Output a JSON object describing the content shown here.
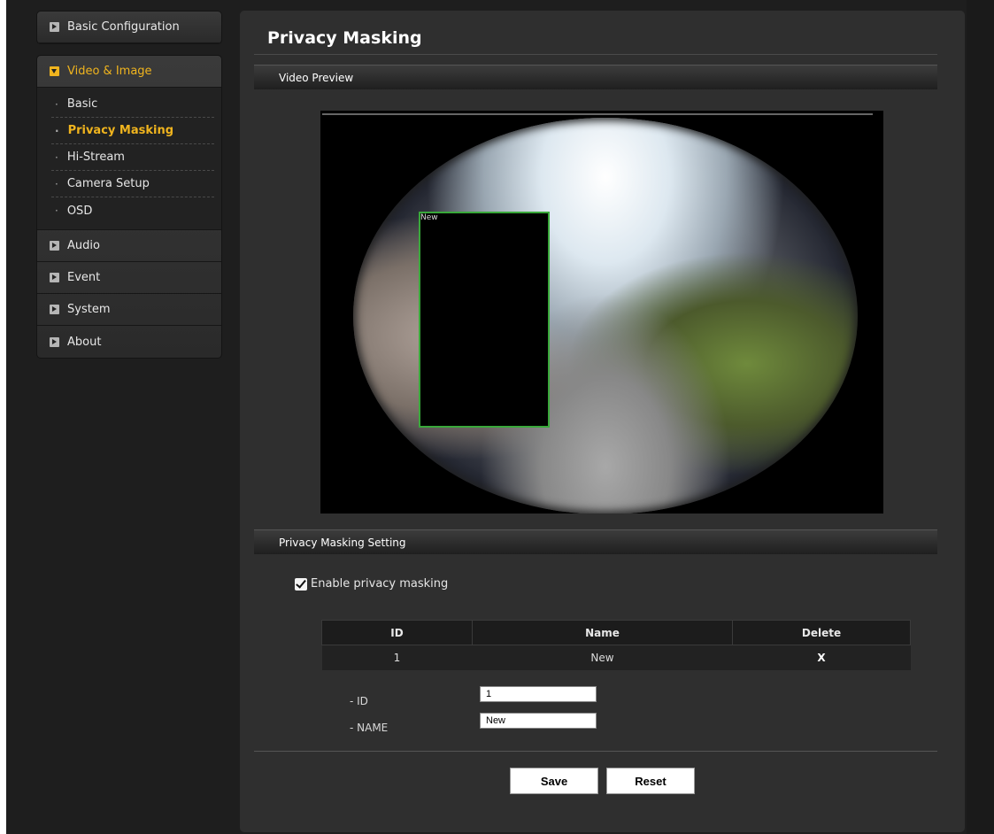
{
  "sidebar": {
    "basic_configuration": "Basic Configuration",
    "video_image": "Video & Image",
    "sub_items": [
      {
        "label": "Basic"
      },
      {
        "label": "Privacy Masking"
      },
      {
        "label": "Hi-Stream"
      },
      {
        "label": "Camera Setup"
      },
      {
        "label": "OSD"
      }
    ],
    "audio": "Audio",
    "event": "Event",
    "system": "System",
    "about": "About"
  },
  "page": {
    "title": "Privacy Masking",
    "video_preview_header": "Video Preview",
    "mask_overlay_label": "New",
    "settings_header": "Privacy Masking Setting",
    "enable_label": "Enable privacy masking",
    "enable_checked": true
  },
  "table": {
    "headers": {
      "id": "ID",
      "name": "Name",
      "delete": "Delete"
    },
    "rows": [
      {
        "id": "1",
        "name": "New",
        "delete": "X"
      }
    ]
  },
  "form": {
    "id_label": "- ID",
    "id_value": "1",
    "name_label": "- NAME",
    "name_value": "New"
  },
  "buttons": {
    "save": "Save",
    "reset": "Reset"
  },
  "colors": {
    "accent": "#f0b41e",
    "mask_border": "#39a83a"
  }
}
